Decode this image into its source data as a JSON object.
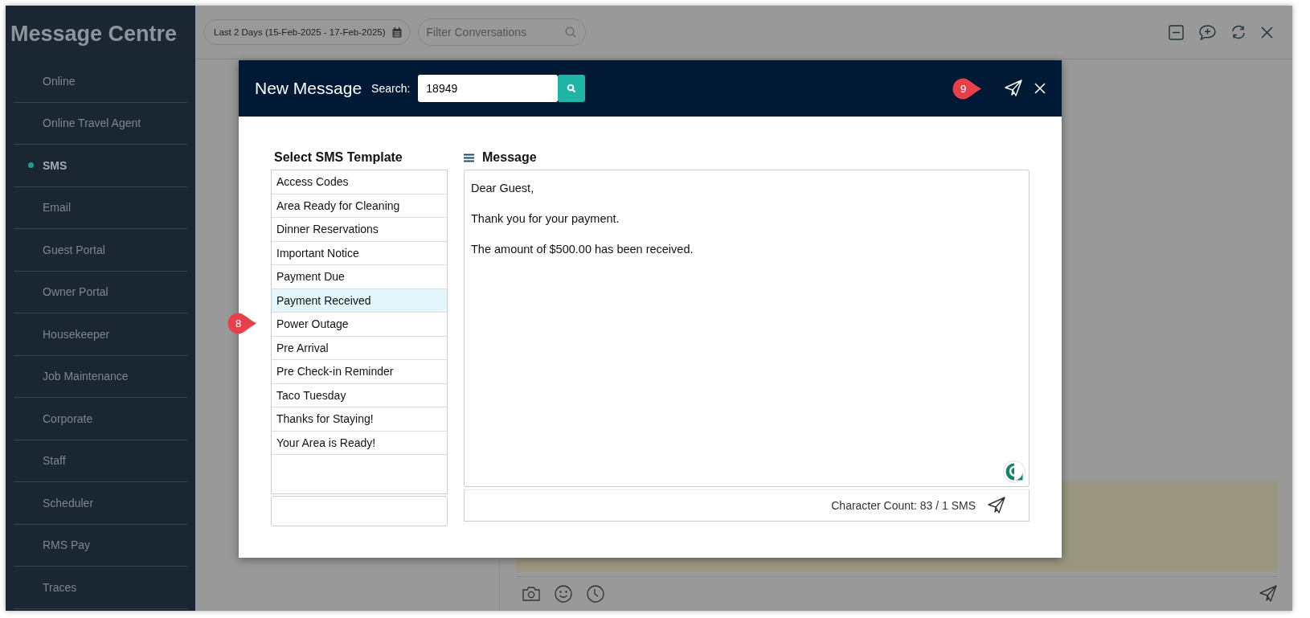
{
  "sidebar": {
    "title": "Message Centre",
    "items": [
      {
        "label": "Online",
        "selected": false
      },
      {
        "label": "Online Travel Agent",
        "selected": false
      },
      {
        "label": "SMS",
        "selected": true
      },
      {
        "label": "Email",
        "selected": false
      },
      {
        "label": "Guest Portal",
        "selected": false
      },
      {
        "label": "Owner Portal",
        "selected": false
      },
      {
        "label": "Housekeeper",
        "selected": false
      },
      {
        "label": "Job Maintenance",
        "selected": false
      },
      {
        "label": "Corporate",
        "selected": false
      },
      {
        "label": "Staff",
        "selected": false
      },
      {
        "label": "Scheduler",
        "selected": false
      },
      {
        "label": "RMS Pay",
        "selected": false
      },
      {
        "label": "Traces",
        "selected": false
      }
    ]
  },
  "toolbar": {
    "date_range": "Last 2 Days (15-Feb-2025 - 17-Feb-2025)",
    "filter": {
      "placeholder": "Filter Conversations"
    }
  },
  "dialog": {
    "title": "New Message",
    "search_label": "Search:",
    "search_value": "18949",
    "callout": "9",
    "templates": {
      "heading": "Select SMS Template",
      "callout": "8",
      "items": [
        {
          "label": "Access Codes",
          "selected": false
        },
        {
          "label": "Area Ready for Cleaning",
          "selected": false
        },
        {
          "label": "Dinner Reservations",
          "selected": false
        },
        {
          "label": "Important Notice",
          "selected": false
        },
        {
          "label": "Payment Due",
          "selected": false
        },
        {
          "label": "Payment Received",
          "selected": true
        },
        {
          "label": "Power Outage",
          "selected": false
        },
        {
          "label": "Pre Arrival",
          "selected": false
        },
        {
          "label": "Pre Check-in Reminder",
          "selected": false
        },
        {
          "label": "Taco Tuesday",
          "selected": false
        },
        {
          "label": "Thanks for Staying!",
          "selected": false
        },
        {
          "label": "Your Area is Ready!",
          "selected": false
        }
      ]
    },
    "message": {
      "heading": "Message",
      "paragraphs": [
        "Dear Guest,",
        "Thank you for your payment.",
        "The amount of $500.00 has been received."
      ],
      "character_count": "Character Count: 83 / 1 SMS"
    }
  }
}
